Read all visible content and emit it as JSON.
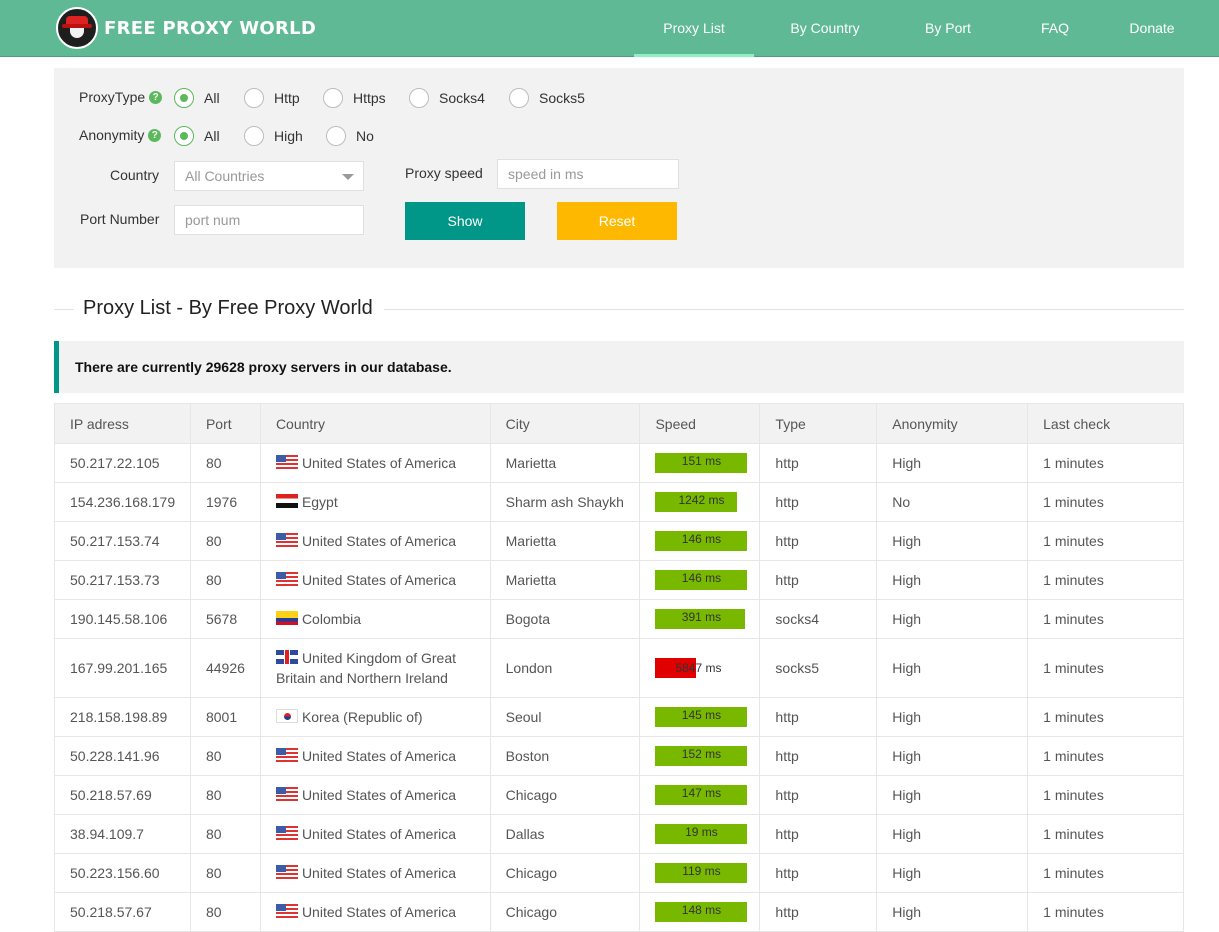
{
  "header": {
    "logo_text": "FREE PROXY WORLD",
    "nav": [
      {
        "label": "Proxy List",
        "active": true
      },
      {
        "label": "By Country",
        "active": false
      },
      {
        "label": "By Port",
        "active": false
      },
      {
        "label": "FAQ",
        "active": false
      },
      {
        "label": "Donate",
        "active": false
      }
    ],
    "bg_color": "#5fb995"
  },
  "filter": {
    "proxy_type_label": "ProxyType",
    "proxy_type_options": [
      "All",
      "Http",
      "Https",
      "Socks4",
      "Socks5"
    ],
    "proxy_type_selected": "All",
    "anonymity_label": "Anonymity",
    "anonymity_options": [
      "All",
      "High",
      "No"
    ],
    "anonymity_selected": "All",
    "help_icon": "?",
    "country_label": "Country",
    "country_value": "All Countries",
    "speed_label": "Proxy speed",
    "speed_placeholder": "speed in ms",
    "port_label": "Port Number",
    "port_placeholder": "port num",
    "show_label": "Show",
    "reset_label": "Reset",
    "show_color": "#009688",
    "reset_color": "#ffb800"
  },
  "section_title": "Proxy List - By Free Proxy World",
  "notice": "There are currently 29628 proxy servers in our database.",
  "table": {
    "headers": [
      "IP adress",
      "Port",
      "Country",
      "City",
      "Speed",
      "Type",
      "Anonymity",
      "Last check"
    ],
    "rows": [
      {
        "ip": "50.217.22.105",
        "port": "80",
        "flag": "us",
        "country": "United States of America",
        "city": "Marietta",
        "speed": "151 ms",
        "speed_fill": 1.0,
        "speed_color": "#78b900",
        "type": "http",
        "anonymity": "High",
        "last_check": "1 minutes"
      },
      {
        "ip": "154.236.168.179",
        "port": "1976",
        "flag": "eg",
        "country": "Egypt",
        "city": "Sharm ash Shaykh",
        "speed": "1242 ms",
        "speed_fill": 0.89,
        "speed_color": "#78b900",
        "type": "http",
        "anonymity": "No",
        "last_check": "1 minutes"
      },
      {
        "ip": "50.217.153.74",
        "port": "80",
        "flag": "us",
        "country": "United States of America",
        "city": "Marietta",
        "speed": "146 ms",
        "speed_fill": 1.0,
        "speed_color": "#78b900",
        "type": "http",
        "anonymity": "High",
        "last_check": "1 minutes"
      },
      {
        "ip": "50.217.153.73",
        "port": "80",
        "flag": "us",
        "country": "United States of America",
        "city": "Marietta",
        "speed": "146 ms",
        "speed_fill": 1.0,
        "speed_color": "#78b900",
        "type": "http",
        "anonymity": "High",
        "last_check": "1 minutes"
      },
      {
        "ip": "190.145.58.106",
        "port": "5678",
        "flag": "co",
        "country": "Colombia",
        "city": "Bogota",
        "speed": "391 ms",
        "speed_fill": 0.98,
        "speed_color": "#78b900",
        "type": "socks4",
        "anonymity": "High",
        "last_check": "1 minutes"
      },
      {
        "ip": "167.99.201.165",
        "port": "44926",
        "flag": "gb",
        "country": "United Kingdom of Great Britain and Northern Ireland",
        "city": "London",
        "speed": "5847 ms",
        "speed_fill": 0.45,
        "speed_color": "#e00000",
        "type": "socks5",
        "anonymity": "High",
        "last_check": "1 minutes"
      },
      {
        "ip": "218.158.198.89",
        "port": "8001",
        "flag": "kr",
        "country": "Korea (Republic of)",
        "city": "Seoul",
        "speed": "145 ms",
        "speed_fill": 1.0,
        "speed_color": "#78b900",
        "type": "http",
        "anonymity": "High",
        "last_check": "1 minutes"
      },
      {
        "ip": "50.228.141.96",
        "port": "80",
        "flag": "us",
        "country": "United States of America",
        "city": "Boston",
        "speed": "152 ms",
        "speed_fill": 1.0,
        "speed_color": "#78b900",
        "type": "http",
        "anonymity": "High",
        "last_check": "1 minutes"
      },
      {
        "ip": "50.218.57.69",
        "port": "80",
        "flag": "us",
        "country": "United States of America",
        "city": "Chicago",
        "speed": "147 ms",
        "speed_fill": 1.0,
        "speed_color": "#78b900",
        "type": "http",
        "anonymity": "High",
        "last_check": "1 minutes"
      },
      {
        "ip": "38.94.109.7",
        "port": "80",
        "flag": "us",
        "country": "United States of America",
        "city": "Dallas",
        "speed": "19 ms",
        "speed_fill": 1.0,
        "speed_color": "#78b900",
        "type": "http",
        "anonymity": "High",
        "last_check": "1 minutes"
      },
      {
        "ip": "50.223.156.60",
        "port": "80",
        "flag": "us",
        "country": "United States of America",
        "city": "Chicago",
        "speed": "119 ms",
        "speed_fill": 1.0,
        "speed_color": "#78b900",
        "type": "http",
        "anonymity": "High",
        "last_check": "1 minutes"
      },
      {
        "ip": "50.218.57.67",
        "port": "80",
        "flag": "us",
        "country": "United States of America",
        "city": "Chicago",
        "speed": "148 ms",
        "speed_fill": 1.0,
        "speed_color": "#78b900",
        "type": "http",
        "anonymity": "High",
        "last_check": "1 minutes"
      }
    ]
  }
}
